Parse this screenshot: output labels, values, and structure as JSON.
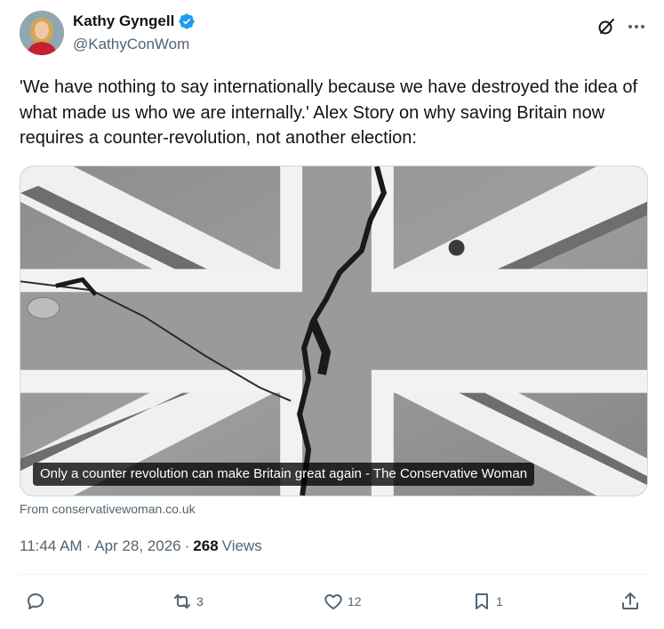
{
  "author": {
    "display_name": "Kathy Gyngell",
    "handle": "@KathyConWom",
    "verified": true
  },
  "tweet": {
    "text": "'We have nothing to say internationally because we have destroyed the idea of what made us who we are internally.'  Alex Story on why saving Britain now requires a counter-revolution, not another election:"
  },
  "card": {
    "caption": "Only a counter revolution can make Britain great again - The Conservative Woman",
    "source": "From conservativewoman.co.uk"
  },
  "meta": {
    "time": "11:44 AM",
    "date": "Apr 28, 2026",
    "separator": "·",
    "views_count": "268",
    "views_label": "Views"
  },
  "actions": {
    "replies": "",
    "reposts": "3",
    "likes": "12",
    "bookmarks": "1"
  },
  "icons": {
    "verified": "verified-badge-icon",
    "grok": "grok-icon",
    "more": "more-icon",
    "reply": "reply-icon",
    "repost": "repost-icon",
    "like": "heart-icon",
    "bookmark": "bookmark-icon",
    "share": "share-icon"
  },
  "colors": {
    "verified": "#1d9bf0",
    "text": "#0f1419",
    "secondary": "#536471",
    "divider": "#eff3f4"
  }
}
